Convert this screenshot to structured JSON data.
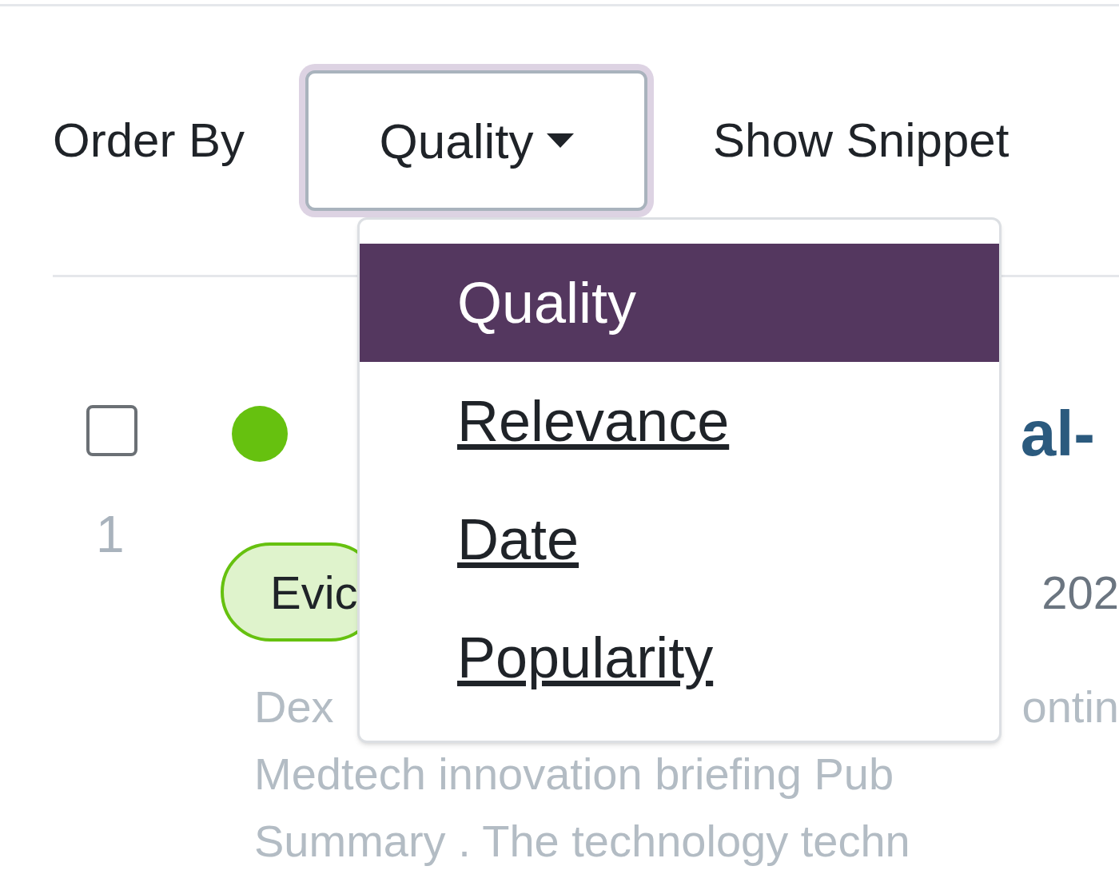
{
  "toolbar": {
    "order_label": "Order By",
    "order_button": "Quality",
    "show_snippets": "Show Snippet"
  },
  "order_menu": [
    {
      "label": "Quality",
      "selected": true
    },
    {
      "label": "Relevance",
      "selected": false
    },
    {
      "label": "Date",
      "selected": false
    },
    {
      "label": "Popularity",
      "selected": false
    }
  ],
  "result": {
    "checked": false,
    "index": "1",
    "color": "#66c10f",
    "title_part": "al-",
    "badge": "Evic",
    "year": "202",
    "snippet_lines": [
      [
        "Dex",
        "ontin"
      ],
      [
        "Medtech innovation briefing Pub"
      ],
      [
        "Summary . The technology techn"
      ]
    ]
  }
}
